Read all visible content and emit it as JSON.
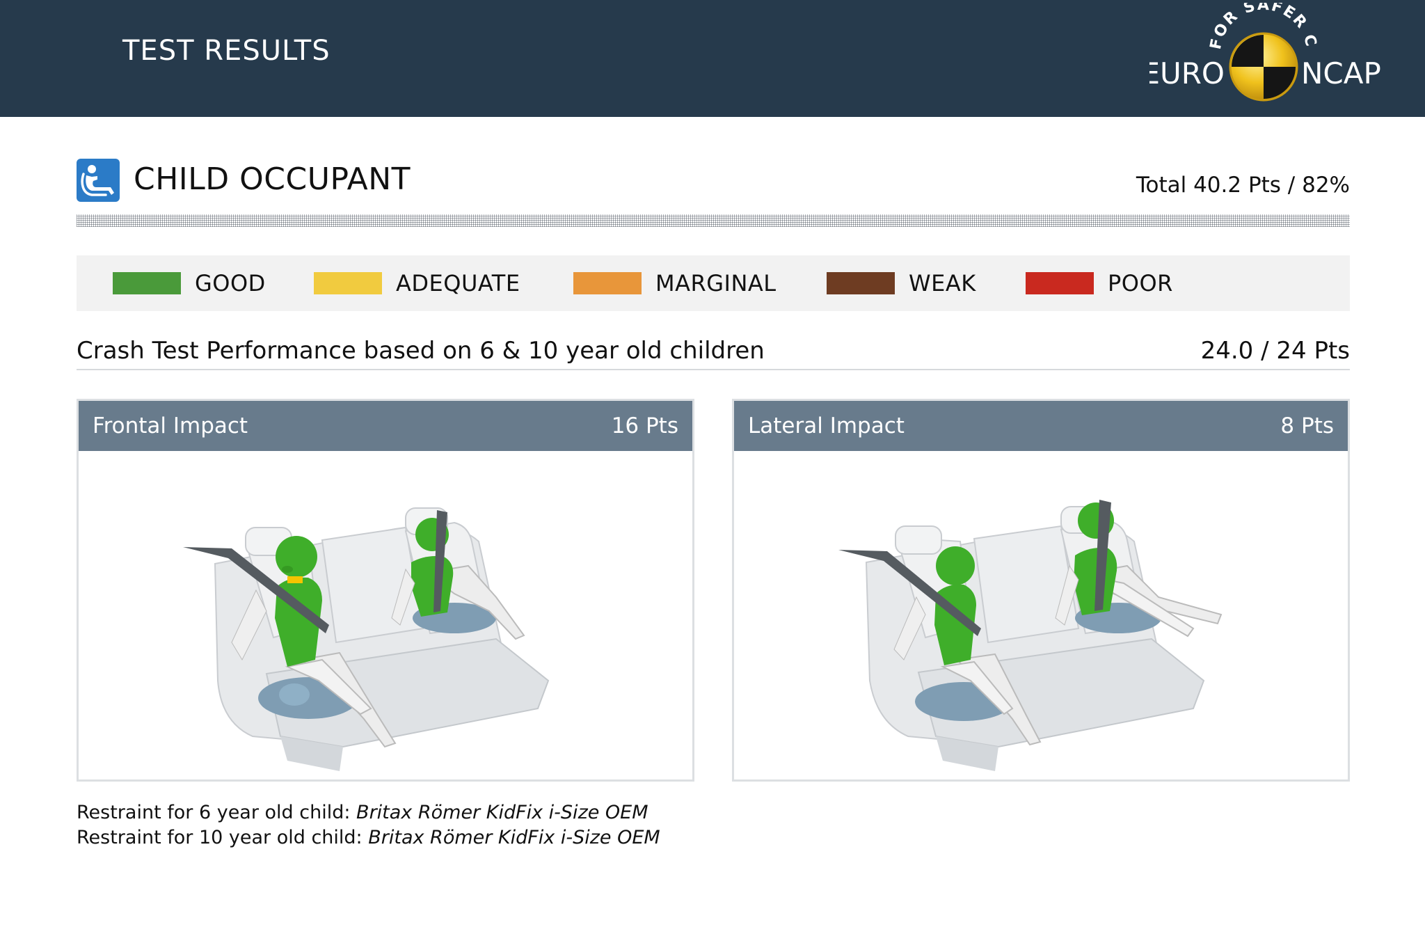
{
  "header": {
    "title": "TEST RESULTS",
    "logo": {
      "arc_text": "FOR SAFER CARS",
      "left_word": "EURO",
      "right_word": "NCAP"
    }
  },
  "section": {
    "icon": "child-seat-icon",
    "title": "CHILD OCCUPANT",
    "total": "Total 40.2 Pts / 82%"
  },
  "legend": [
    {
      "label": "GOOD",
      "color": "#4a9a3a"
    },
    {
      "label": "ADEQUATE",
      "color": "#f1cb3f"
    },
    {
      "label": "MARGINAL",
      "color": "#e8963a"
    },
    {
      "label": "WEAK",
      "color": "#6e3c22"
    },
    {
      "label": "POOR",
      "color": "#c9291f"
    }
  ],
  "crash_test": {
    "label": "Crash Test Performance based on 6 & 10 year old children",
    "score": "24.0 / 24 Pts"
  },
  "panels": [
    {
      "title": "Frontal Impact",
      "points": "16 Pts",
      "illustration": "rear-seat-dummies-frontal"
    },
    {
      "title": "Lateral Impact",
      "points": "8 Pts",
      "illustration": "rear-seat-dummies-lateral"
    }
  ],
  "restraints": [
    {
      "label": "Restraint for 6 year old child: ",
      "value": "Britax Römer KidFix i-Size OEM"
    },
    {
      "label": "Restraint for 10 year old child: ",
      "value": "Britax Römer KidFix i-Size OEM"
    }
  ],
  "colors": {
    "header_bg": "#263a4c",
    "panel_head_bg": "#687b8c",
    "dummy_green": "#3fae2a",
    "seat_grey": "#e4e6e8",
    "booster_blue": "#7f9db3"
  }
}
